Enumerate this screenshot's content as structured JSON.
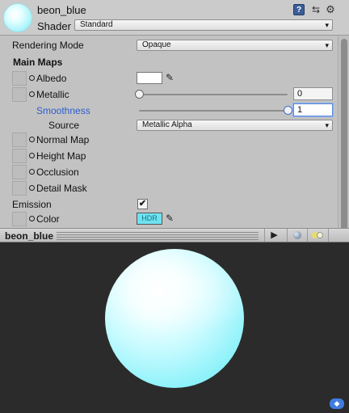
{
  "header": {
    "material_name": "beon_blue",
    "shader_label": "Shader",
    "shader_value": "Standard",
    "icons": [
      "help-book-icon",
      "preset-icon",
      "gear-icon"
    ]
  },
  "properties": {
    "rendering_mode": {
      "label": "Rendering Mode",
      "value": "Opaque"
    },
    "main_maps_heading": "Main Maps",
    "albedo": {
      "label": "Albedo",
      "color": "#ffffff"
    },
    "metallic": {
      "label": "Metallic",
      "value": "0",
      "slider_fraction": 0.0
    },
    "smoothness": {
      "label": "Smoothness",
      "value": "1",
      "slider_fraction": 1.0
    },
    "source": {
      "label": "Source",
      "value": "Metallic Alpha"
    },
    "normal_map": {
      "label": "Normal Map"
    },
    "height_map": {
      "label": "Height Map"
    },
    "occlusion": {
      "label": "Occlusion"
    },
    "detail_mask": {
      "label": "Detail Mask"
    },
    "emission": {
      "label": "Emission",
      "checked": true,
      "check_glyph": "✔"
    },
    "emission_color": {
      "label": "Color",
      "badge": "HDR",
      "color": "#6ee3f0"
    }
  },
  "preview": {
    "title": "beon_blue",
    "sphere_color": "#8ff2fa"
  },
  "colors": {
    "accent_blue": "#2d5dd1",
    "panel_bg": "#c2c2c2",
    "viewport_bg": "#2b2b2b"
  }
}
